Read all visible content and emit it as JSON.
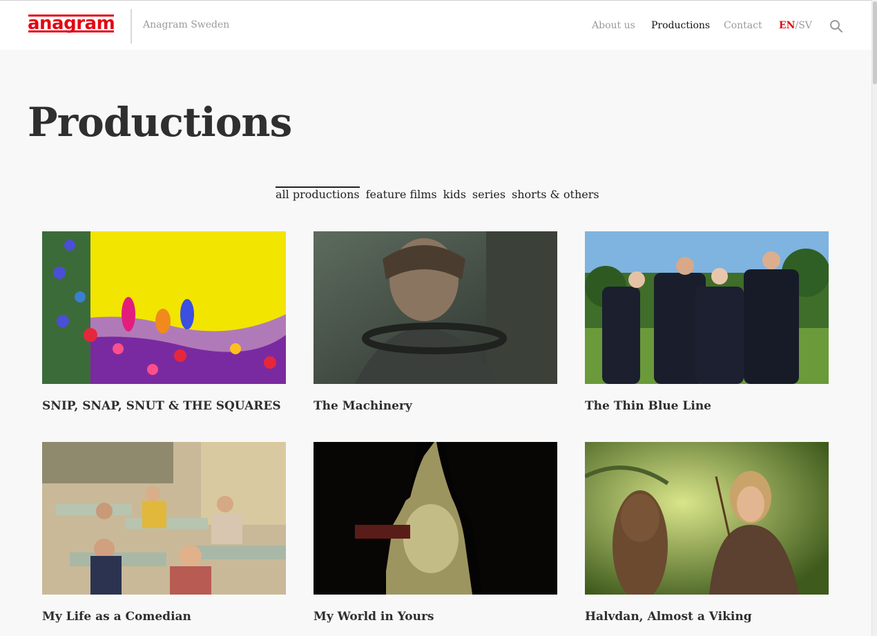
{
  "header": {
    "logo_text": "anagram",
    "brand_subtitle": "Anagram Sweden",
    "nav": [
      {
        "label": "About us",
        "active": false
      },
      {
        "label": "Productions",
        "active": true
      },
      {
        "label": "Contact",
        "active": false
      }
    ],
    "lang": {
      "current": "EN",
      "separator": "/",
      "other": "SV"
    },
    "search_icon": "search-icon"
  },
  "page": {
    "title": "Productions"
  },
  "filters": [
    {
      "label": "all productions",
      "active": true
    },
    {
      "label": "feature films",
      "active": false
    },
    {
      "label": "kids",
      "active": false
    },
    {
      "label": "series",
      "active": false
    },
    {
      "label": "shorts & others",
      "active": false
    }
  ],
  "productions": [
    {
      "title": "SNIP, SNAP, SNUT & THE SQUARES"
    },
    {
      "title": "The Machinery"
    },
    {
      "title": "The Thin Blue Line"
    },
    {
      "title": "My Life as a Comedian"
    },
    {
      "title": "My World in Yours"
    },
    {
      "title": "Halvdan, Almost a Viking"
    }
  ],
  "colors": {
    "accent": "#e30613",
    "background": "#f8f8f8",
    "header_bg": "#ffffff",
    "text": "#2b2b2b"
  }
}
